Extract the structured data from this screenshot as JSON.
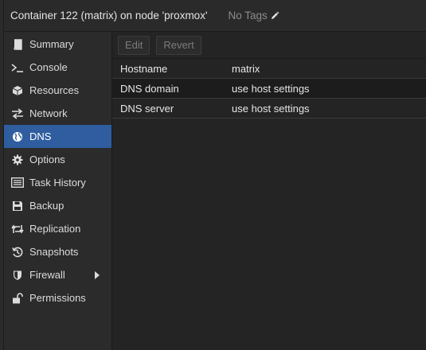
{
  "header": {
    "title": "Container 122 (matrix) on node 'proxmox'",
    "tags_label": "No Tags"
  },
  "sidebar": {
    "items": [
      {
        "label": "Summary",
        "icon": "book-icon"
      },
      {
        "label": "Console",
        "icon": "terminal-icon"
      },
      {
        "label": "Resources",
        "icon": "cube-icon"
      },
      {
        "label": "Network",
        "icon": "exchange-icon"
      },
      {
        "label": "DNS",
        "icon": "globe-icon",
        "active": true
      },
      {
        "label": "Options",
        "icon": "gear-icon"
      },
      {
        "label": "Task History",
        "icon": "list-icon"
      },
      {
        "label": "Backup",
        "icon": "floppy-icon"
      },
      {
        "label": "Replication",
        "icon": "retweet-icon"
      },
      {
        "label": "Snapshots",
        "icon": "history-icon"
      },
      {
        "label": "Firewall",
        "icon": "shield-icon",
        "has_submenu": true
      },
      {
        "label": "Permissions",
        "icon": "unlock-icon"
      }
    ]
  },
  "toolbar": {
    "edit_label": "Edit",
    "revert_label": "Revert"
  },
  "grid": {
    "rows": [
      {
        "key": "Hostname",
        "value": "matrix"
      },
      {
        "key": "DNS domain",
        "value": "use host settings"
      },
      {
        "key": "DNS server",
        "value": "use host settings"
      }
    ]
  },
  "colors": {
    "accent": "#2f5da0",
    "background": "#242424",
    "sidebar": "#2b2b2b"
  }
}
